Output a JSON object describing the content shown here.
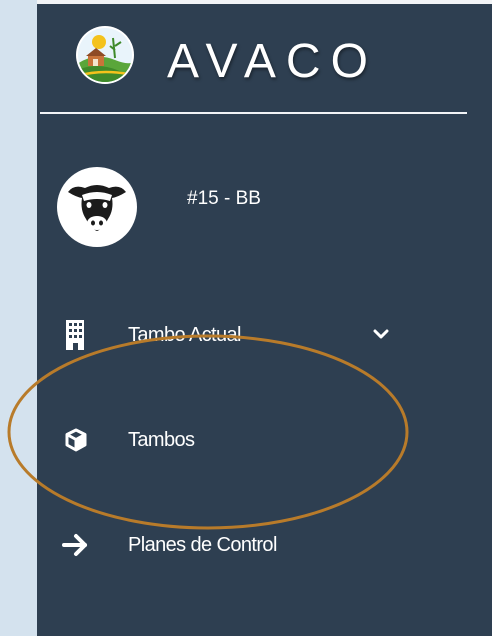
{
  "app": {
    "brand_name": "AVACO",
    "logo_icon": "farm-logo-icon"
  },
  "user": {
    "name": "#15 - BB",
    "avatar_icon": "cow-head-icon"
  },
  "menu": {
    "items": [
      {
        "label": "Tambo Actual",
        "icon": "building-icon",
        "has_submenu": true
      },
      {
        "label": "Tambos",
        "icon": "cube-icon",
        "has_submenu": false
      },
      {
        "label": "Planes de Control",
        "icon": "arrow-right-icon",
        "has_submenu": false
      }
    ]
  },
  "colors": {
    "sidebar_bg": "#2e3f51",
    "page_bg": "#d4e2ee",
    "text": "#ffffff",
    "annotation": "#b87b2a"
  }
}
